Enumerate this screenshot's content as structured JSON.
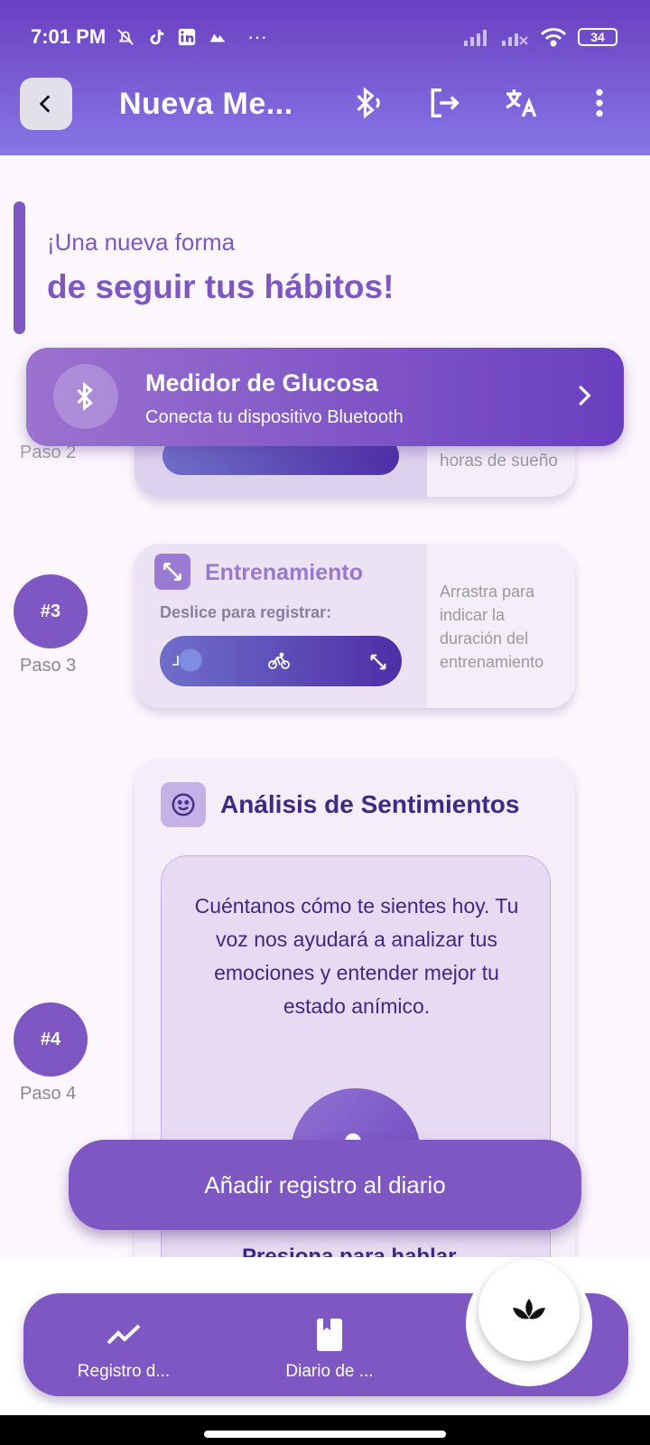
{
  "status_bar": {
    "time": "7:01 PM",
    "battery": "34",
    "more_icons": "···"
  },
  "app_bar": {
    "title": "Nueva Me...",
    "icons": [
      "back-icon",
      "bluetooth-audio-icon",
      "logout-icon",
      "translate-icon",
      "more-vert-icon"
    ]
  },
  "header": {
    "line1": "¡Una nueva forma",
    "line2": "de seguir tus hábitos!"
  },
  "glucose_banner": {
    "title": "Medidor de Glucosa",
    "subtitle": "Conecta tu dispositivo Bluetooth"
  },
  "step2": {
    "label_partial": "Paso 2",
    "hint_partial": "horas de sueño"
  },
  "step3": {
    "badge": "#3",
    "label": "Paso 3",
    "title": "Entrenamiento",
    "instruction": "Deslice para registrar:",
    "hint": "Arrastra para indicar la duración del entrenamiento"
  },
  "step4": {
    "badge": "#4",
    "label": "Paso 4",
    "title": "Análisis de Sentimientos",
    "body": "Cuéntanos cómo te sientes hoy. Tu voz nos ayudará a analizar tus emociones y entender mejor tu estado anímico.",
    "press_label": "Presiona para hablar"
  },
  "add_button": "Añadir registro al diario",
  "bottom_nav": {
    "items": [
      {
        "label": "Registro d...",
        "icon": "trending-up-icon"
      },
      {
        "label": "Diario de ...",
        "icon": "book-icon"
      }
    ],
    "fab_icon": "lotus-icon"
  },
  "colors": {
    "primary": "#7e57c2",
    "dark_text": "#3c2a86",
    "background": "#fcf6fd"
  }
}
